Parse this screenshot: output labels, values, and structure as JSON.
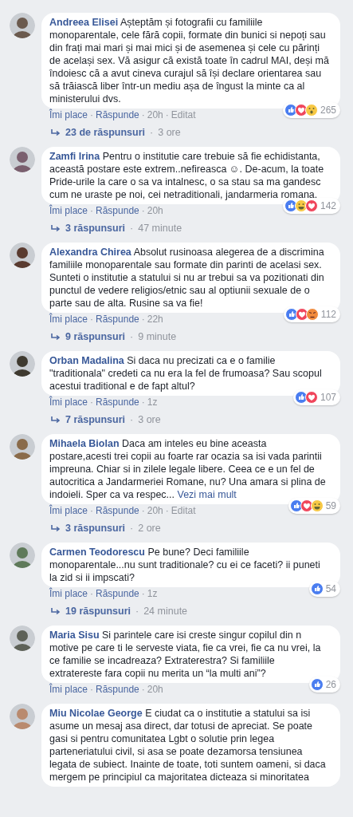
{
  "separator": "·",
  "comments": [
    {
      "author": "Andreea Elisei",
      "text": "Așteptăm și fotografii cu familiile monoparentale, cele fără copii, formate din bunici si nepoți sau din frați mai mari și mai mici și de asemenea și cele cu părinți de același sex. Vă asigur că există toate în cadrul MAI, deși mă îndoiesc că a avut cineva curajul să își declare orientarea sau să trăiască liber într-un mediu așa de îngust la minte ca al ministerului dvs.",
      "like": "Îmi place",
      "reply": "Răspunde",
      "time": "20h",
      "edited": "Editat",
      "reactions": [
        {
          "kind": "like"
        },
        {
          "kind": "love"
        },
        {
          "kind": "wow"
        }
      ],
      "reaction_count": "265",
      "replies": "23 de răspunsuri",
      "replies_time": "3 ore"
    },
    {
      "author": "Zamfi Irina",
      "text": "Pentru o institutie care trebuie să fie echidistanta, această postare este extrem..nefireasca ☺. De-acum, la toate Pride-urile la care o sa va intalnesc, o sa stau sa ma gandesc cum ne uraste pe noi, cei netraditionali, jandarmeria romana.",
      "like": "Îmi place",
      "reply": "Răspunde",
      "time": "20h",
      "reactions": [
        {
          "kind": "like"
        },
        {
          "kind": "haha"
        },
        {
          "kind": "love"
        }
      ],
      "reaction_count": "142",
      "replies": "3 răspunsuri",
      "replies_time": "47 minute"
    },
    {
      "author": "Alexandra Chirea",
      "text": "Absolut rusinoasa alegerea de a discrimina familiile monoparentale sau formate din parinti de acelasi sex. Sunteti o institutie a statului si nu ar trebui sa va pozitionati din punctul de vedere religios/etnic sau al optiunii sexuale de o parte sau de alta. Rusine sa va fie!",
      "like": "Îmi place",
      "reply": "Răspunde",
      "time": "22h",
      "reactions": [
        {
          "kind": "like"
        },
        {
          "kind": "love"
        },
        {
          "kind": "angry"
        }
      ],
      "reaction_count": "112",
      "replies": "9 răspunsuri",
      "replies_time": "9 minute"
    },
    {
      "author": "Orban Madalina",
      "text": "Si daca nu precizati ca e o familie \"traditionala\" credeti ca nu era la fel de frumoasa? Sau scopul acestui traditional e de fapt altul?",
      "like": "Îmi place",
      "reply": "Răspunde",
      "time": "1z",
      "reactions": [
        {
          "kind": "like"
        },
        {
          "kind": "love"
        }
      ],
      "reaction_count": "107",
      "replies": "7 răspunsuri",
      "replies_time": "3 ore"
    },
    {
      "author": "Mihaela Biolan",
      "text": "Daca am inteles eu bine aceasta postare,acesti trei copii au foarte rar ocazia sa isi vada parintii impreuna. Chiar si in zilele legale libere. Ceea ce e un fel de autocritica a Jandarmeriei Romane, nu? Una amara si plina de indoieli. Sper ca va respec...",
      "more": "Vezi mai mult",
      "like": "Îmi place",
      "reply": "Răspunde",
      "time": "20h",
      "edited": "Editat",
      "reactions": [
        {
          "kind": "like"
        },
        {
          "kind": "love"
        },
        {
          "kind": "haha"
        }
      ],
      "reaction_count": "59",
      "replies": "3 răspunsuri",
      "replies_time": "2 ore"
    },
    {
      "author": "Carmen Teodorescu",
      "text": "Pe bune? Deci familiile monoparentale...nu sunt traditionale? cu ei ce faceti? ii puneti la zid si ii impscati?",
      "like": "Îmi place",
      "reply": "Răspunde",
      "time": "1z",
      "reactions": [
        {
          "kind": "like"
        }
      ],
      "reaction_count": "54",
      "replies": "19 răspunsuri",
      "replies_time": "24 minute"
    },
    {
      "author": "Maria Sisu",
      "text": "Si parintele care isi creste singur copilul din n motive pe care ti le serveste viata, fie ca vrei, fie ca nu vrei, la ce familie se incadreaza? Extraterestra? Si familiile extratereste fara copii nu merita un “la multi ani”?",
      "like": "Îmi place",
      "reply": "Răspunde",
      "time": "20h",
      "reactions": [
        {
          "kind": "like"
        }
      ],
      "reaction_count": "26"
    },
    {
      "author": "Miu Nicolae George",
      "text": "E ciudat ca o institutie a statului sa isi asume un mesaj asa direct, dar totusi de apreciat. Se poate gasi si pentru comunitatea Lgbt o solutie prin legea parteneriatului civil, si asa se poate dezamorsa tensiunea legata de subiect. Inainte de toate, toti suntem oameni, si daca mergem pe principiul ca majoritatea dicteaza si minoritatea"
    }
  ]
}
